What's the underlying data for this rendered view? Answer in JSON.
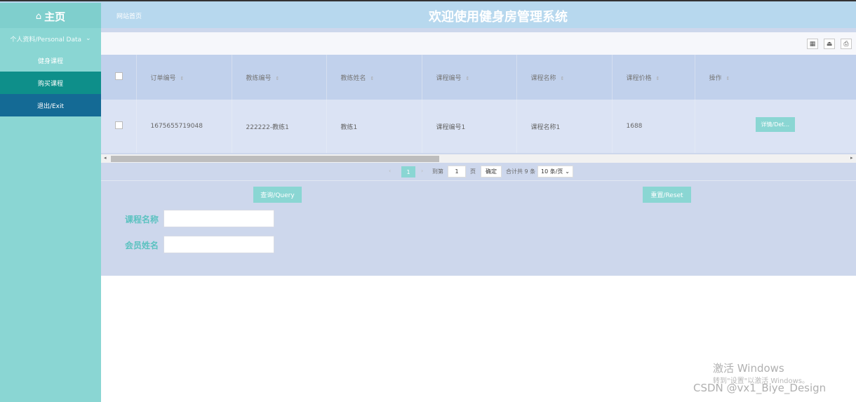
{
  "header": {
    "brand_label": "主页",
    "site_link": "网站首页",
    "title": "欢迎使用健身房管理系统"
  },
  "sidebar": {
    "group_label": "个人资料/Personal Data",
    "items": [
      {
        "label": "健身课程"
      },
      {
        "label": "购买课程"
      },
      {
        "label": "退出/Exit"
      }
    ]
  },
  "toolbar": {
    "icons": [
      "columns-icon",
      "export-icon",
      "print-icon"
    ]
  },
  "table": {
    "columns": [
      "订单编号",
      "教练编号",
      "教练姓名",
      "课程编号",
      "课程名称",
      "课程价格",
      "操作"
    ],
    "rows": [
      {
        "order_no": "1675655719048",
        "coach_no": "222222-教练1",
        "coach_name": "教练1",
        "course_no": "课程编号1",
        "course_name": "课程名称1",
        "price": "1688",
        "action_label": "详情/Det..."
      }
    ]
  },
  "pagination": {
    "current_page": "1",
    "goto_label": "到第",
    "goto_value": "1",
    "page_unit": "页",
    "confirm_label": "确定",
    "total_label": "合计共 9 条",
    "page_size": "10 条/页"
  },
  "buttons": {
    "query": "查询/Query",
    "reset": "重置/Reset"
  },
  "form": {
    "course_name_label": "课程名称",
    "member_name_label": "会员姓名",
    "course_name_value": "",
    "member_name_value": ""
  },
  "watermark": {
    "activate_title": "激活 Windows",
    "activate_hint": "转到\"设置\"以激活 Windows。",
    "csdn": "CSDN @vx1_Biye_Design"
  }
}
